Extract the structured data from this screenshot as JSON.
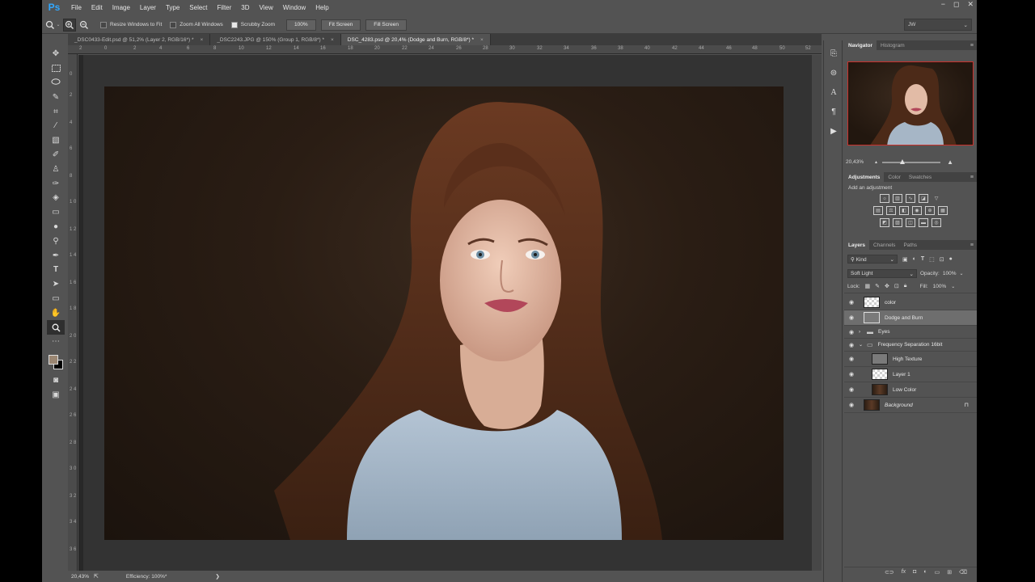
{
  "app": {
    "logo": "Ps",
    "menu": [
      "File",
      "Edit",
      "Image",
      "Layer",
      "Type",
      "Select",
      "Filter",
      "3D",
      "View",
      "Window",
      "Help"
    ],
    "window_controls": [
      "−",
      "◻",
      "✕"
    ]
  },
  "options_bar": {
    "zoom_in_icon": "zoom-in-icon",
    "zoom_out_icon": "zoom-out-icon",
    "resize_windows_label": "Resize Windows to Fit",
    "resize_windows_checked": false,
    "zoom_all_label": "Zoom All Windows",
    "zoom_all_checked": false,
    "scrubby_label": "Scrubby Zoom",
    "scrubby_checked": true,
    "btn_100": "100%",
    "btn_fit": "Fit Screen",
    "btn_fill": "Fill Screen",
    "workspace": "JW"
  },
  "tabs": [
    {
      "label": "_DSC0433-Edit.psd @ 51,2% (Layer 2, RGB/16*) *",
      "active": false
    },
    {
      "label": "_DSC2243.JPG @ 150% (Group 1, RGB/8*) *",
      "active": false
    },
    {
      "label": "DSC_4283.psd @ 20,4% (Dodge and Burn, RGB/8*) *",
      "active": true
    }
  ],
  "tab_close": "×",
  "ruler": {
    "top": [
      "2",
      "0",
      "2",
      "4",
      "6",
      "8",
      "10",
      "12",
      "14",
      "16",
      "18",
      "20",
      "22",
      "24",
      "26",
      "28",
      "30",
      "32",
      "34",
      "36",
      "38",
      "40",
      "42",
      "44",
      "46",
      "48",
      "50",
      "52"
    ],
    "left": [
      "0",
      "2",
      "4",
      "6",
      "8",
      "1 0",
      "1 2",
      "1 4",
      "1 6",
      "1 8",
      "2 0",
      "2 2",
      "2 4",
      "2 6",
      "2 8",
      "3 0",
      "3 2",
      "3 4",
      "3 6"
    ]
  },
  "status": {
    "zoom": "20,43%",
    "efficiency": "Efficiency: 100%*",
    "arrow": "❯"
  },
  "navigator": {
    "tabs": [
      "Navigator",
      "Histogram"
    ],
    "zoom": "20,43%",
    "zoom_level": 0.3
  },
  "adjustments": {
    "tabs": [
      "Adjustments",
      "Color",
      "Swatches"
    ],
    "heading": "Add an adjustment",
    "row1": [
      "brightness-icon",
      "levels-icon",
      "curves-icon",
      "exposure-icon",
      "vibrance-icon"
    ],
    "row2": [
      "hue-sat-icon",
      "color-balance-icon",
      "bw-icon",
      "photo-filter-icon",
      "channel-mixer-icon",
      "color-lookup-icon"
    ],
    "row3": [
      "invert-icon",
      "posterize-icon",
      "threshold-icon",
      "gradient-map-icon",
      "selective-color-icon"
    ]
  },
  "layers": {
    "tabs": [
      "Layers",
      "Channels",
      "Paths"
    ],
    "filter": "Kind",
    "blend_mode": "Soft Light",
    "opacity_label": "Opacity:",
    "opacity": "100%",
    "lock_label": "Lock:",
    "fill_label": "Fill:",
    "fill": "100%",
    "items": [
      {
        "name": "color",
        "thumb": "check",
        "indent": 0,
        "selected": false,
        "group": false
      },
      {
        "name": "Dodge and Burn",
        "thumb": "gray",
        "indent": 0,
        "selected": true,
        "group": false
      },
      {
        "name": "Eyes",
        "thumb": "folder",
        "indent": 0,
        "selected": false,
        "group": true,
        "open": false
      },
      {
        "name": "Frequency Separation 16bit",
        "thumb": "folder",
        "indent": 0,
        "selected": false,
        "group": true,
        "open": true
      },
      {
        "name": "High Texture",
        "thumb": "gray",
        "indent": 1,
        "selected": false,
        "group": false
      },
      {
        "name": "Layer 1",
        "thumb": "check",
        "indent": 1,
        "selected": false,
        "group": false
      },
      {
        "name": "Low Color",
        "thumb": "photo",
        "indent": 1,
        "selected": false,
        "group": false
      },
      {
        "name": "Background",
        "thumb": "photo",
        "indent": 0,
        "selected": false,
        "group": false,
        "italic": true,
        "locked": true
      }
    ]
  }
}
